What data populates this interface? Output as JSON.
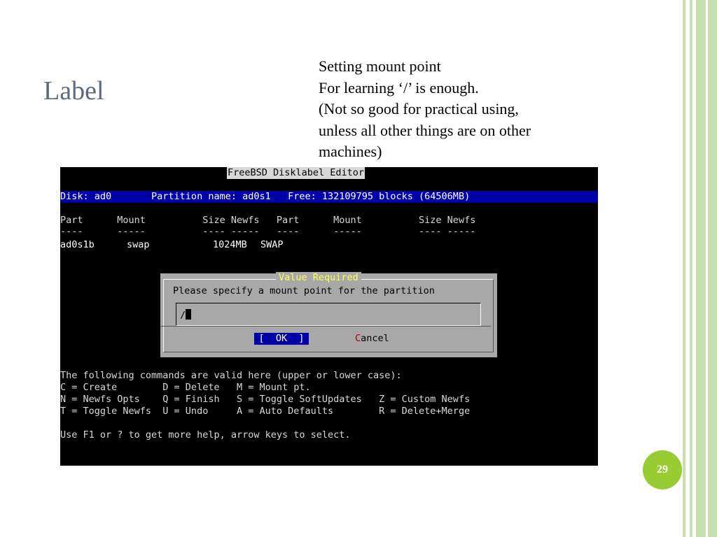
{
  "slide": {
    "title": "Label",
    "notes": [
      "Setting mount point",
      "For learning ‘/’ is enough.",
      "(Not so good for practical using,",
      "unless all other things are on other",
      "machines)"
    ],
    "page_number": "29",
    "accent_color": "#99cc33"
  },
  "terminal": {
    "title": "FreeBSD Disklabel Editor",
    "disk_bar": "Disk: ad0       Partition name: ad0s1   Free: 132109795 blocks (64506MB)",
    "table_header": "Part      Mount          Size Newfs   Part      Mount          Size Newfs",
    "table_rule": "----      -----          ---- -----   ----      -----          ---- -----",
    "rows": [
      {
        "part": "ad0s1b",
        "mount": "swap",
        "size": "1024MB",
        "newfs": "SWAP"
      }
    ],
    "dialog": {
      "title": "Value Required",
      "prompt": "Please specify a mount point for the partition",
      "input_value": "/",
      "ok_label": "[  OK  ]",
      "cancel_hotkey": "C",
      "cancel_rest": "ancel"
    },
    "help_lines": [
      "The following commands are valid here (upper or lower case):",
      "C = Create        D = Delete   M = Mount pt.",
      "N = Newfs Opts    Q = Finish   S = Toggle SoftUpdates   Z = Custom Newfs",
      "T = Toggle Newfs  U = Undo     A = Auto Defaults        R = Delete+Merge"
    ],
    "footer": "Use F1 or ? to get more help, arrow keys to select."
  }
}
